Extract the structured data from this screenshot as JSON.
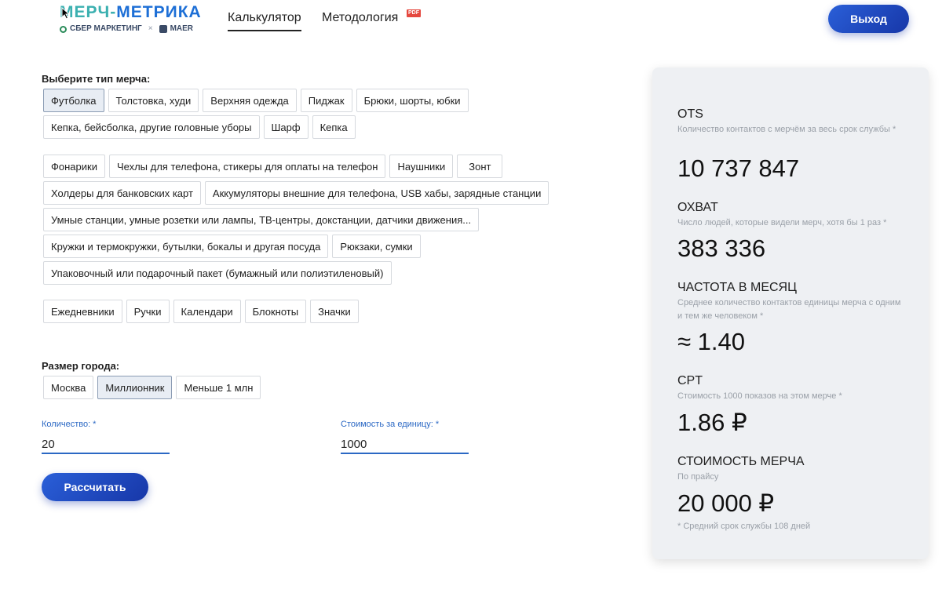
{
  "header": {
    "logo_part1": "МЕРЧ-",
    "logo_part2": "МЕТРИКА",
    "logo_sber": "СБЕР МАРКЕТИНГ",
    "logo_x": "×",
    "logo_maer": "MAER",
    "tabs": [
      "Калькулятор",
      "Методология"
    ],
    "pdf_badge": "PDF",
    "exit_label": "Выход"
  },
  "merch": {
    "label": "Выберите тип мерча:",
    "rows": [
      [
        "Футболка",
        "Толстовка, худи",
        "Верхняя одежда",
        "Пиджак",
        "Брюки, шорты, юбки"
      ],
      [
        "Кепка, бейсболка, другие головные уборы",
        "Шарф",
        "Кепка"
      ],
      [
        "Фонарики",
        "Чехлы для телефона, стикеры для оплаты на телефон",
        "Наушники",
        "Зонт"
      ],
      [
        "Холдеры для банковских карт",
        "Аккумуляторы внешние для телефона, USB хабы, зарядные станции"
      ],
      [
        "Умные станции, умные розетки или лампы, ТВ-центры, докстанции, датчики движения..."
      ],
      [
        "Кружки и термокружки, бутылки, бокалы и другая посуда",
        "Рюкзаки, сумки"
      ],
      [
        "Упаковочный или подарочный пакет (бумажный или полиэтиленовый)"
      ],
      [
        "Ежедневники",
        "Ручки",
        "Календари",
        "Блокноты",
        "Значки"
      ]
    ],
    "selected": "Футболка"
  },
  "city": {
    "label": "Размер города:",
    "options": [
      "Москва",
      "Миллионник",
      "Меньше 1 млн"
    ],
    "selected": "Миллионник"
  },
  "quantity": {
    "label": "Количество: *",
    "value": "20"
  },
  "unit_cost": {
    "label": "Стоимость за единицу: *",
    "value": "1000"
  },
  "calculate_label": "Рассчитать",
  "results": {
    "ots": {
      "title": "OTS",
      "desc": "Количество контактов с мерчём за весь срок службы *",
      "value": "10 737 847"
    },
    "reach": {
      "title": "ОХВАТ",
      "desc": "Число людей, которые видели мерч, хотя бы 1 раз *",
      "value": "383 336"
    },
    "frequency": {
      "title": "ЧАСТОТА В МЕСЯЦ",
      "desc": "Среднее количество контактов единицы мерча с одним и тем же человеком *",
      "value": "≈ 1.40"
    },
    "cpt": {
      "title": "CPT",
      "desc": "Стоимость 1000 показов на этом мерче *",
      "value": "1.86 ₽"
    },
    "cost": {
      "title": "СТОИМОСТЬ МЕРЧА",
      "desc": "По прайсу",
      "value": "20 000 ₽"
    },
    "footnote": "* Средний срок службы 108 дней"
  }
}
